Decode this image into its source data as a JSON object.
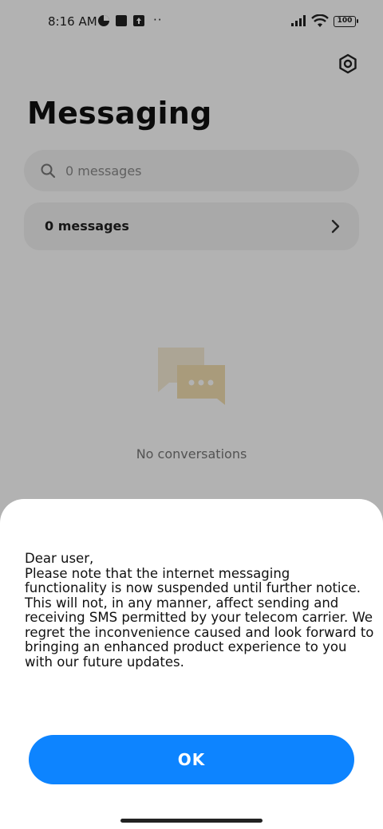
{
  "status_bar": {
    "time": "8:16 AM",
    "dots": "··",
    "battery": "100"
  },
  "header": {
    "title": "Messaging"
  },
  "search": {
    "placeholder": "0 messages"
  },
  "messages_row": {
    "label": "0 messages"
  },
  "empty_state": {
    "text": "No conversations"
  },
  "dialog": {
    "message": "Dear user,\nPlease note that the internet messaging functionality is now suspended until further notice. This will not, in any manner, affect sending and receiving SMS permitted by your telecom carrier. We regret the inconvenience caused and look forward to bringing an enhanced product experience to you with our future updates.",
    "ok_label": "OK"
  },
  "colors": {
    "accent": "#0d84ff",
    "scrim": "rgba(0,0,0,0.30)"
  },
  "icons": [
    "settings-icon",
    "search-icon",
    "chevron-right-icon",
    "conversations-icon"
  ]
}
